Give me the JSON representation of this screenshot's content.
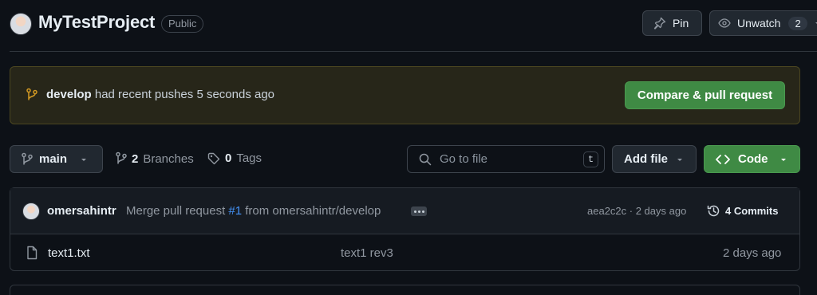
{
  "header": {
    "repo_name": "MyTestProject",
    "visibility": "Public",
    "pin_label": "Pin",
    "watch_label": "Unwatch",
    "watch_count": "2"
  },
  "banner": {
    "branch": "develop",
    "message": " had recent pushes 5 seconds ago",
    "action_label": "Compare & pull request"
  },
  "toolbar": {
    "branch_label": "main",
    "branches_count": "2",
    "branches_label": "Branches",
    "tags_count": "0",
    "tags_label": "Tags",
    "search_placeholder": "Go to file",
    "search_shortcut": "t",
    "add_file_label": "Add file",
    "code_label": "Code"
  },
  "latest_commit": {
    "author": "omersahintr",
    "message_prefix": "Merge pull request ",
    "pr_link": "#1",
    "message_suffix": " from omersahintr/develop",
    "hash_and_time": "aea2c2c · 2 days ago",
    "commits_count": "4",
    "commits_label": "Commits"
  },
  "files": [
    {
      "name": "text1.txt",
      "commit_message": "text1 rev3",
      "updated": "2 days ago"
    }
  ],
  "colors": {
    "background": "#0d1117",
    "accent_green": "#3f8a44",
    "link_blue": "#4493f8",
    "banner_bg": "#272619",
    "branch_icon": "#d29922"
  }
}
